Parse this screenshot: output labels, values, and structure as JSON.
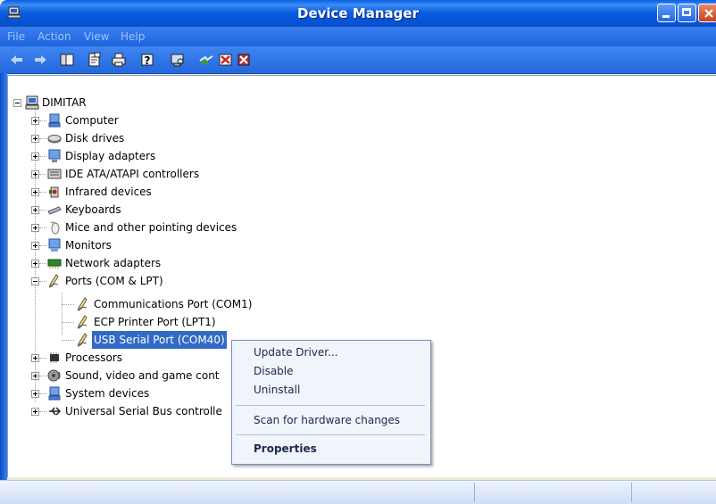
{
  "window": {
    "title": "Device Manager"
  },
  "menu": [
    "File",
    "Action",
    "View",
    "Help"
  ],
  "toolbar": {
    "buttons": [
      "back-icon",
      "forward-icon",
      "console-tree-icon",
      "properties-icon",
      "print-icon",
      "help-icon",
      "scan-icon",
      "update-driver-icon",
      "disable-icon",
      "uninstall-icon"
    ]
  },
  "tree": {
    "root": "DIMITAR",
    "categories": [
      {
        "label": "Computer",
        "icon": "computer-icon"
      },
      {
        "label": "Disk drives",
        "icon": "disk-drive-icon"
      },
      {
        "label": "Display adapters",
        "icon": "display-adapter-icon"
      },
      {
        "label": "IDE ATA/ATAPI controllers",
        "icon": "ide-controller-icon"
      },
      {
        "label": "Infrared devices",
        "icon": "infrared-icon"
      },
      {
        "label": "Keyboards",
        "icon": "keyboard-icon"
      },
      {
        "label": "Mice and other pointing devices",
        "icon": "mouse-icon"
      },
      {
        "label": "Monitors",
        "icon": "monitor-icon"
      },
      {
        "label": "Network adapters",
        "icon": "network-adapter-icon"
      },
      {
        "label": "Ports (COM & LPT)",
        "icon": "port-icon"
      },
      {
        "label": "Processors",
        "icon": "processor-icon"
      },
      {
        "label": "Sound, video and game cont",
        "icon": "sound-icon"
      },
      {
        "label": "System devices",
        "icon": "system-device-icon"
      },
      {
        "label": "Universal Serial Bus controlle",
        "icon": "usb-icon"
      }
    ],
    "ports_children": [
      {
        "label": "Communications Port (COM1)"
      },
      {
        "label": "ECP Printer Port (LPT1)"
      },
      {
        "label": "USB Serial Port (COM40)"
      }
    ]
  },
  "context_menu": {
    "items": [
      "Update Driver...",
      "Disable",
      "Uninstall",
      "Scan for hardware changes",
      "Properties"
    ]
  },
  "colors": {
    "title_bar": "#0a5fe4",
    "selection": "#316ac5",
    "menu_bg": "#f0f4fb"
  }
}
